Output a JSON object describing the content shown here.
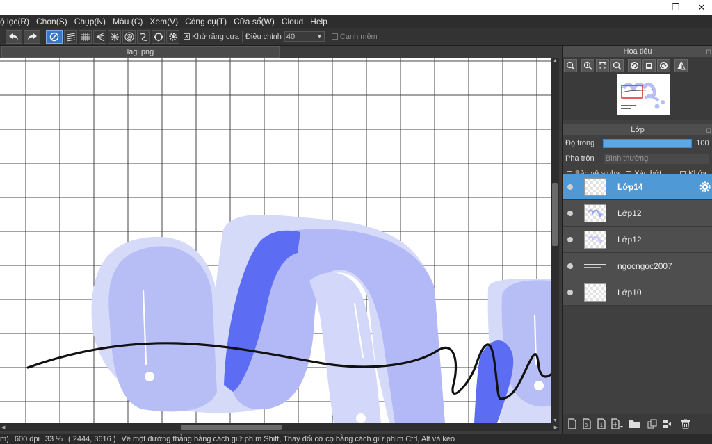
{
  "window": {
    "minimize_label": "—",
    "maximize_label": "❐",
    "close_label": "✕"
  },
  "menu": [
    "ộ lọc(R)",
    "Chọn(S)",
    "Chụp(N)",
    "Màu (C)",
    "Xem(V)",
    "Công cụ(T)",
    "Cửa sổ(W)",
    "Cloud",
    "Help"
  ],
  "toolbar": {
    "antialias_label": "Khử răng cưa",
    "antialias_checked": true,
    "adjust_label": "Điều chỉnh",
    "adjust_value": "40",
    "soft_edge_label": "Cạnh mềm",
    "soft_edge_checked": false,
    "icons": [
      "undo-icon",
      "redo-icon",
      "no-snap-icon",
      "parallel-snap-icon",
      "grid-snap-icon",
      "perspective-snap-icon",
      "radial-snap-icon",
      "concentric-snap-icon",
      "curve-snap-icon",
      "circle-snap-icon",
      "snap-settings-icon"
    ]
  },
  "document": {
    "tab_title": "lagi.png"
  },
  "navigator": {
    "title": "Hoa tiêu"
  },
  "layers": {
    "title": "Lớp",
    "opacity_label": "Độ trong",
    "opacity_value": "100",
    "opacity_fraction": 1.0,
    "blend_label": "Pha trộn",
    "blend_value": "Bình thường",
    "protect_alpha_label": "Bảo vệ alpha",
    "clipping_label": "Xén bớt",
    "lock_label": "Khóa",
    "items": [
      {
        "name": "Lớp14",
        "selected": true
      },
      {
        "name": "Lớp12",
        "selected": false
      },
      {
        "name": "Lớp12",
        "selected": false
      },
      {
        "name": "ngocngoc2007",
        "selected": false
      },
      {
        "name": "Lớp10",
        "selected": false
      }
    ]
  },
  "status": {
    "unit": "m)",
    "dpi": "600 dpi",
    "zoom": "33 %",
    "coords": "( 2444, 3616 )",
    "hint": "Vẽ một đường thẳng bằng cách giữ phím Shift, Thay đổi cỡ cọ bằng cách giữ phím Ctrl, Alt và kéo"
  },
  "colors": {
    "accent": "#4f9ad6",
    "stroke_light": "#b6bdf7",
    "stroke_pale": "#d3d8fb",
    "stroke_deep": "#5b6cf5",
    "ink": "#111111"
  }
}
